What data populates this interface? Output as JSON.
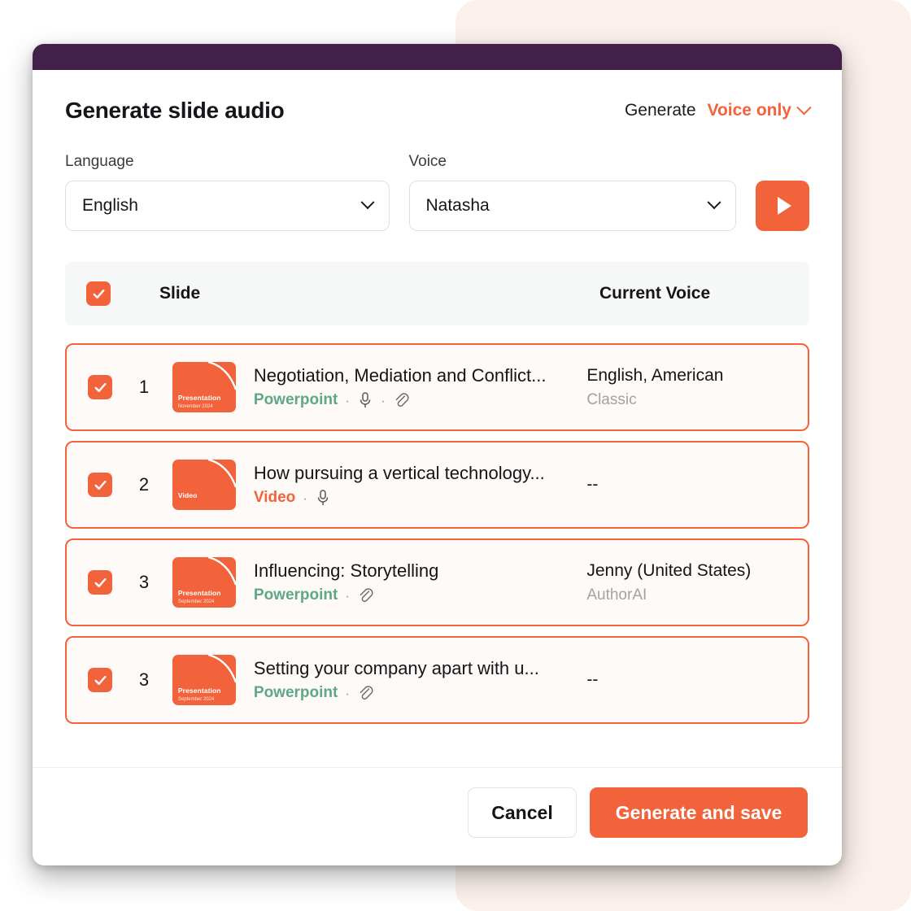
{
  "window": {
    "topbar_color": "#42204A",
    "background_panel_color": "#FBF1EC",
    "accent_color": "#F2633C",
    "green_color": "#5EA886"
  },
  "dialog": {
    "title": "Generate slide audio",
    "generate_label": "Generate",
    "mode_value": "Voice only"
  },
  "form": {
    "language": {
      "label": "Language",
      "value": "English"
    },
    "voice": {
      "label": "Voice",
      "value": "Natasha"
    },
    "preview_icon": "play-icon"
  },
  "table": {
    "header": {
      "select_all_icon": "checkmark-icon",
      "slide_column": "Slide",
      "voice_column": "Current Voice"
    },
    "rows": [
      {
        "checked": true,
        "number": "1",
        "thumb_label": "Presentation",
        "thumb_date": "November 2024",
        "title": "Negotiation, Mediation and Conflict...",
        "type": "Powerpoint",
        "type_style": "ppt",
        "icons": [
          "mic-icon",
          "paperclip-icon"
        ],
        "voice": "English, American",
        "voice_sub": "Classic"
      },
      {
        "checked": true,
        "number": "2",
        "thumb_label": "Video",
        "thumb_date": "",
        "title": "How pursuing a vertical technology...",
        "type": "Video",
        "type_style": "video",
        "icons": [
          "mic-icon"
        ],
        "voice": "--",
        "voice_sub": ""
      },
      {
        "checked": true,
        "number": "3",
        "thumb_label": "Presentation",
        "thumb_date": "September 2024",
        "title": "Influencing: Storytelling",
        "type": "Powerpoint",
        "type_style": "ppt",
        "icons": [
          "paperclip-icon"
        ],
        "voice": "Jenny (United States)",
        "voice_sub": "AuthorAI"
      },
      {
        "checked": true,
        "number": "3",
        "thumb_label": "Presentation",
        "thumb_date": "September 2024",
        "title": "Setting your company apart with u...",
        "type": "Powerpoint",
        "type_style": "ppt",
        "icons": [
          "paperclip-icon"
        ],
        "voice": "--",
        "voice_sub": ""
      }
    ]
  },
  "footer": {
    "cancel_label": "Cancel",
    "primary_label": "Generate and save"
  }
}
